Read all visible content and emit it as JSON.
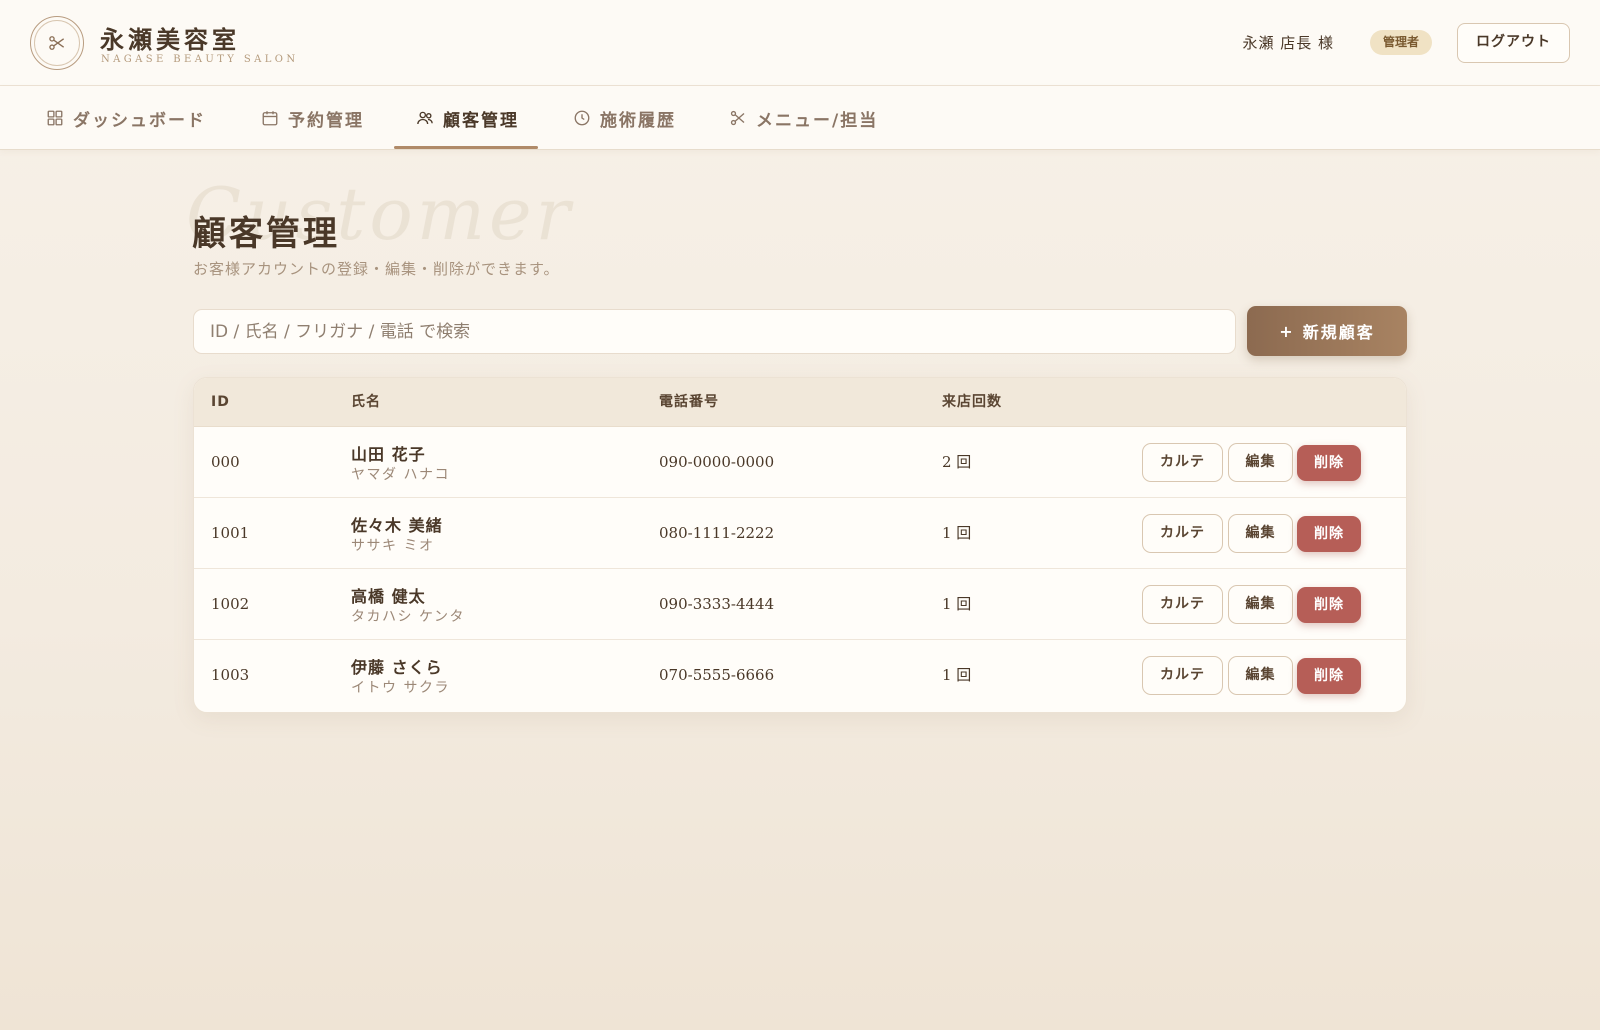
{
  "header": {
    "brand_name": "永瀬美容室",
    "brand_sub": "NAGASE BEAUTY SALON",
    "user_name": "永瀬 店長 様",
    "role_badge": "管理者",
    "logout_label": "ログアウト"
  },
  "nav": {
    "items": [
      {
        "label": "ダッシュボード",
        "icon": "dashboard-icon"
      },
      {
        "label": "予約管理",
        "icon": "calendar-icon"
      },
      {
        "label": "顧客管理",
        "icon": "users-icon"
      },
      {
        "label": "施術履歴",
        "icon": "clock-icon"
      },
      {
        "label": "メニュー/担当",
        "icon": "scissors-icon"
      }
    ],
    "active": "顧客管理"
  },
  "page": {
    "watermark": "Customer",
    "title": "顧客管理",
    "description": "お客様アカウントの登録・編集・削除ができます。"
  },
  "search": {
    "placeholder": "ID / 氏名 / フリガナ / 電話 で検索",
    "value": ""
  },
  "new_button_label": "新規顧客",
  "table": {
    "columns": [
      "ID",
      "氏名",
      "電話番号",
      "来店回数"
    ],
    "rows": [
      {
        "id": "000",
        "name": "山田 花子",
        "kana": "ヤマダ ハナコ",
        "tel": "090-0000-0000",
        "visits": "2 回"
      },
      {
        "id": "1001",
        "name": "佐々木 美緒",
        "kana": "ササキ ミオ",
        "tel": "080-1111-2222",
        "visits": "1 回"
      },
      {
        "id": "1002",
        "name": "高橋 健太",
        "kana": "タカハシ ケンタ",
        "tel": "090-3333-4444",
        "visits": "1 回"
      },
      {
        "id": "1003",
        "name": "伊藤 さくら",
        "kana": "イトウ サクラ",
        "tel": "070-5555-6666",
        "visits": "1 回"
      }
    ],
    "actions": {
      "karte": "カルテ",
      "edit": "編集",
      "delete": "削除"
    }
  },
  "colors": {
    "accent": "#a88362",
    "danger": "#b65e57",
    "text": "#4a3828",
    "badge_bg": "#f0e2c4"
  }
}
